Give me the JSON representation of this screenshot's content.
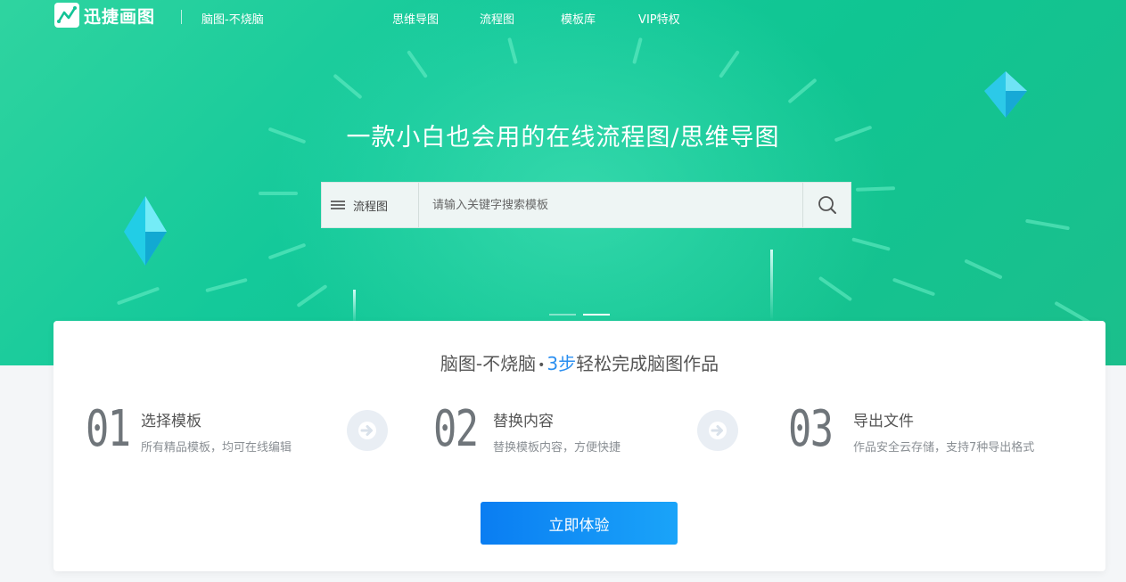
{
  "nav": {
    "logo_text": "迅捷画图",
    "slogan": "脑图-不烧脑",
    "links": [
      {
        "label": "思维导图"
      },
      {
        "label": "流程图"
      },
      {
        "label": "模板库"
      },
      {
        "label": "VIP特权"
      }
    ]
  },
  "hero": {
    "title": "一款小白也会用的在线流程图/思维导图",
    "bg_color": "#14c99a"
  },
  "search": {
    "category": "流程图",
    "placeholder": "请输入关键字搜索模板",
    "value": ""
  },
  "carousel": {
    "slides": 2,
    "active": 2
  },
  "card": {
    "title_prefix": "脑图-不烧脑",
    "title_sep": "•",
    "title_highlight": "3步",
    "title_suffix": "轻松完成脑图作品",
    "highlight_color": "#2b8ff0",
    "steps": [
      {
        "num": "01",
        "title": "选择模板",
        "desc": "所有精品模板，均可在线编辑"
      },
      {
        "num": "02",
        "title": "替换内容",
        "desc": "替换模板内容，方便快捷"
      },
      {
        "num": "03",
        "title": "导出文件",
        "desc": "作品安全云存储，支持7种导出格式"
      }
    ],
    "cta_label": "立即体验",
    "cta_color": "#0a7df2"
  },
  "icons": {
    "logo": "chart-line-icon",
    "menu": "hamburger-icon",
    "search": "search-icon",
    "arrow": "arrow-right-icon"
  }
}
